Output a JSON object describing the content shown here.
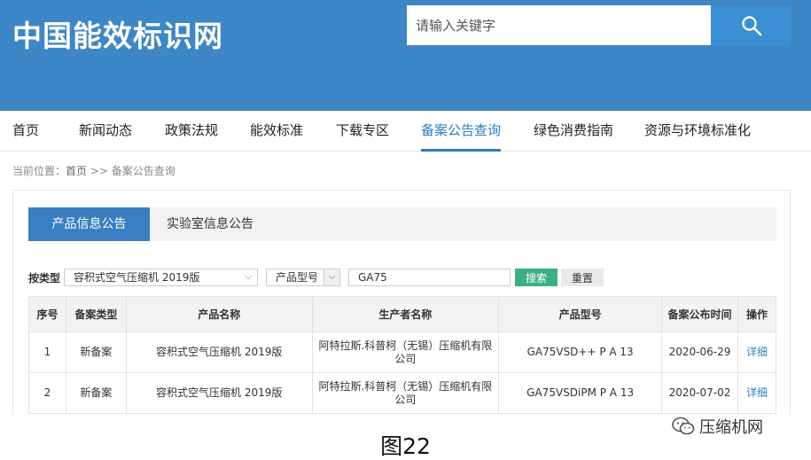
{
  "header": {
    "logo": "中国能效标识网",
    "search_placeholder": "请输入关键字"
  },
  "nav": {
    "items": [
      "首页",
      "新闻动态",
      "政策法规",
      "能效标准",
      "下载专区",
      "备案公告查询",
      "绿色消费指南",
      "资源与环境标准化"
    ],
    "active": "备案公告查询"
  },
  "breadcrumb": {
    "prefix": "当前位置：",
    "home": "首页",
    "separator": " >> ",
    "current": "备案公告查询"
  },
  "tabs": [
    "产品信息公告",
    "实验室信息公告"
  ],
  "filter": {
    "label": "按类型",
    "type_value": "容积式空气压缩机 2019版",
    "field_value": "产品型号",
    "query_value": "GA75",
    "search_label": "搜索",
    "reset_label": "重置"
  },
  "table": {
    "headers": [
      "序号",
      "备案类型",
      "产品名称",
      "生产者名称",
      "产品型号",
      "备案公布时间",
      "操作"
    ],
    "rows": [
      [
        "1",
        "新备案",
        "容积式空气压缩机 2019版",
        "阿特拉斯.科普柯（无锡）压缩机有限公司",
        "GA75VSD++ P A 13",
        "2020-06-29",
        "详细"
      ],
      [
        "2",
        "新备案",
        "容积式空气压缩机 2019版",
        "阿特拉斯.科普柯（无锡）压缩机有限公司",
        "GA75VSDiPM P A 13",
        "2020-07-02",
        "详细"
      ]
    ]
  },
  "caption": "图22",
  "watermark": "压缩机网"
}
